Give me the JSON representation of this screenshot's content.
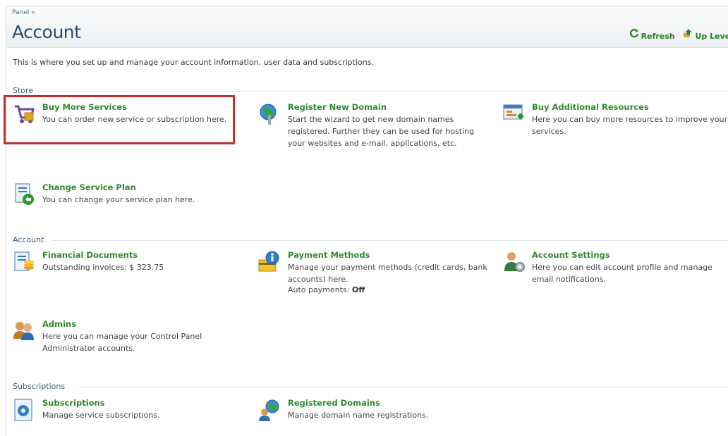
{
  "header": {
    "breadcrumb": "Panel »",
    "title": "Account",
    "refresh_label": "Refresh",
    "up_level_label": "Up Level"
  },
  "intro": "This is where you set up and manage your account information, user data and subscriptions.",
  "sections": {
    "store": "Store",
    "account": "Account",
    "subscriptions": "Subscriptions"
  },
  "items": {
    "buy_more_services": {
      "title": "Buy More Services",
      "desc": "You can order new service or subscription here."
    },
    "register_new_domain": {
      "title": "Register New Domain",
      "desc": "Start the wizard to get new domain names registered. Further they can be used for hosting your websites and e-mail, applications, etc."
    },
    "buy_additional_resources": {
      "title": "Buy Additional Resources",
      "desc": "Here you can buy more resources to improve your services."
    },
    "change_service_plan": {
      "title": "Change Service Plan",
      "desc": "You can change your service plan here."
    },
    "financial_documents": {
      "title": "Financial Documents",
      "desc": "Outstanding invoices: $ 323.75"
    },
    "payment_methods": {
      "title": "Payment Methods",
      "desc": "Manage your payment methods (credit cards, bank accounts) here.",
      "auto_label": "Auto payments:",
      "auto_value": "Off"
    },
    "account_settings": {
      "title": "Account Settings",
      "desc": "Here you can edit account profile and manage email notifications."
    },
    "admins": {
      "title": "Admins",
      "desc": "Here you can manage your Control Panel Administrator accounts."
    },
    "subscriptions": {
      "title": "Subscriptions",
      "desc": "Manage service subscriptions."
    },
    "registered_domains": {
      "title": "Registered Domains",
      "desc": "Manage domain name registrations."
    }
  },
  "colors": {
    "title_blue": "#1f4e79",
    "link_green": "#2e8b2e",
    "highlight_red": "#c32f2f"
  }
}
